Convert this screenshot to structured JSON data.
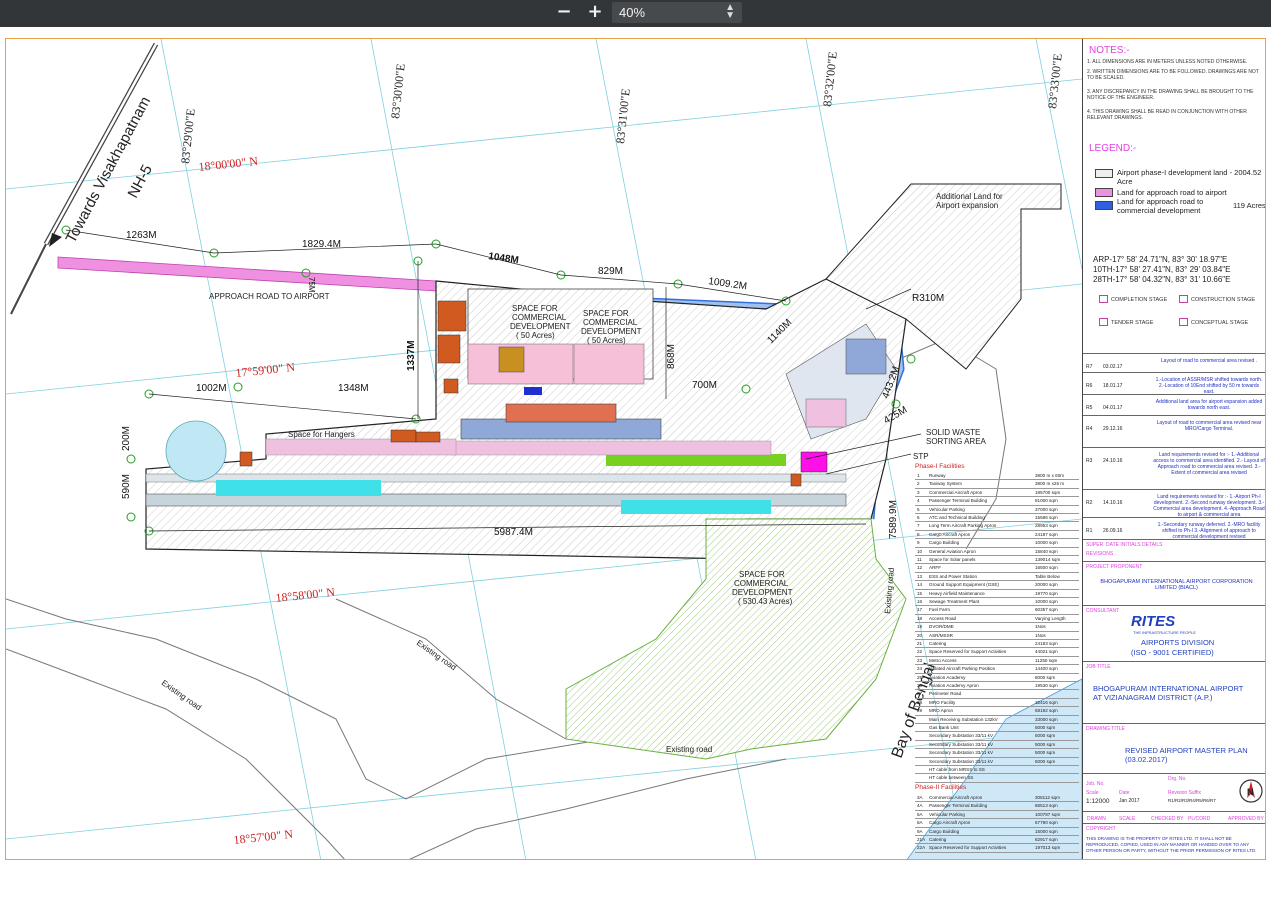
{
  "toolbar": {
    "zoom_out": "−",
    "zoom_in": "+",
    "zoom_value": "40%"
  },
  "map_labels": {
    "towards": "Towards Visakhapatnam",
    "nh5": "NH-5",
    "lon1": "83°29'00\"E",
    "lon2": "83°30'00\"E",
    "lon3": "83°31'00\"E",
    "lon4": "83°32'00\"E",
    "lon5": "83°33'00\"E",
    "lat1": "18°00'00\" N",
    "lat2": "17°59'00\" N",
    "lat3": "18°58'00\" N",
    "lat4": "18°57'00\" N",
    "d1263": "1263M",
    "d1829": "1829.4M",
    "d1048": "1048M",
    "d829": "829M",
    "d1009": "1009.2M",
    "d1140": "1140M",
    "dR310": "R310M",
    "d1337": "1337M",
    "d868": "868M",
    "d700": "700M",
    "d443": "443.2M",
    "d425": "425M",
    "d1002": "1002M",
    "d1348": "1348M",
    "d200": "200M",
    "d590": "590M",
    "d5987": "5987.4M",
    "d7589": "7589.9M",
    "d75": "75M",
    "approach": "APPROACH ROAD TO AIRPORT",
    "space1a": "SPACE FOR",
    "space1b": "COMMERCIAL",
    "space1c": "DEVELOPMENT",
    "space1d": "( 50 Acres)",
    "space3d": "( 530.43 Acres)",
    "hangers": "Space for Hangers",
    "solid1": "SOLID WASTE",
    "solid2": "SORTING AREA",
    "stp": "STP",
    "additional1": "Additional Land for",
    "additional2": "Airport expansion",
    "existing": "Existing road",
    "bay": "Bay of Bengal"
  },
  "notes": {
    "title": "NOTES:-",
    "items": [
      "1. ALL DIMENSIONS ARE IN METERS UNLESS NOTED OTHERWISE.",
      "2. WRITTEN DIMENSIONS ARE TO BE FOLLOWED. DRAWINGS ARE NOT TO BE SCALED.",
      "3. ANY DISCREPANCY IN THE DRAWING SHALL BE BROUGHT TO THE NOTICE OF THE ENGINEER.",
      "4. THIS DRAWING SHALL BE READ IN CONJUNCTION WITH OTHER RELEVANT DRAWINGS."
    ]
  },
  "legend": {
    "title": "LEGEND:-",
    "phase1": "Airport phase-I development land - 2004.52 Acre",
    "approach": "Land for approach road to airport",
    "commercial1": "Land for approach road to",
    "commercial2": "commercial development",
    "acres": "119 Acres",
    "arp": "ARP-17° 58' 24.71\"N, 83° 30' 18.97\"E",
    "th10": "10TH-17° 58' 27.41\"N, 83° 29' 03.84\"E",
    "th28": "28TH-17° 58' 04.32\"N, 83° 31' 10.66\"E",
    "completion": "COMPLETION STAGE",
    "construction": "CONSTRUCTION STAGE",
    "tender": "TENDER STAGE",
    "conceptual": "CONCEPTUAL STAGE"
  },
  "revisions": [
    {
      "no": "R7",
      "date": "03.02.17",
      "text": "Layout of road to commercial area revised ."
    },
    {
      "no": "R6",
      "date": "18.01.17",
      "text": "1.-Location of ASSR/MSR shifted towards north. 2.-Location of 10End shifted by 50 m towards east."
    },
    {
      "no": "R5",
      "date": "04.01.17",
      "text": "Additional land area for airport expansion added towards north east."
    },
    {
      "no": "R4",
      "date": "29.12.16",
      "text": "Layout of road to commercial area revised near MRO/Cargo Terminal."
    },
    {
      "no": "R3",
      "date": "24.10.16",
      "text": "Land requirements revised for :- 1.-Additional access to commercial area identified. 2.- Layout of Approach road to commercial area revised. 3.-Extent of commercial area revised"
    },
    {
      "no": "R2",
      "date": "14.10.16",
      "text": "Land requirements revised for :- 1.-Airport Ph-I development. 2.-Second runway development. 3.-Commercial area development. 4.-Approach Road to airport & commercial area"
    },
    {
      "no": "R1",
      "date": "26.09.16",
      "text": "1.-Secondary runway deferred. 2.-MRO facility shifted to Ph-I 3.-Alignment of approach to commercial development revised"
    }
  ],
  "title_block": {
    "rev_header": "SUPER.   DATE   INITIALS          DETAILS",
    "revisions_lbl": "REVISIONS",
    "proponent_lbl": "PROJECT PROPONENT",
    "proponent": "BHOGAPURAM INTERNATIONAL AIRPORT CORPORATION LIMITED (BIACL)",
    "consultant_lbl": "CONSULTANT",
    "rites": "RITES",
    "rites_tag": "THE INFRASTRUCTURE PEOPLE",
    "division": "AIRPORTS DIVISION",
    "iso": "(ISO - 9001 CERTIFIED)",
    "job_lbl": "JOB TITLE",
    "job1": "BHOGAPURAM INTERNATIONAL AIRPORT",
    "job2": "AT VIZIANAGRAM DISTRICT (A.P.)",
    "drawing_lbl": "DRAWING TITLE",
    "drawing1": "REVISED AIRPORT MASTER PLAN",
    "drawing2": "(03.02.2017)",
    "job_no_lbl": "Job. No.",
    "drg_no_lbl": "Drg. No.",
    "scale_lbl": "Scale",
    "scale": "1:12000",
    "date_lbl": "Date",
    "date": "Jan 2017",
    "revision_lbl": "Revision Suffix",
    "revision": "R1/R2/R3/R4/R5/R6/R7",
    "drawn": "DRAWN",
    "scale2": "SCALE",
    "checked": "CHECKED BY",
    "pl": "PL/CORD",
    "approved": "APPROVED BY",
    "copyright_lbl": "COPYRIGHT",
    "copyright": "THIS DRAWING IS THE PROPERTY OF RITES LTD. IT SHALL NOT BE REPRODUCED, COPIED, USED IN ANY MANNER OR HANDED OVER TO ANY OTHER PERSON OR PARTY, WITHOUT THE PRIOR PERMISSION OF RITES LTD."
  },
  "phase1": {
    "title": "Phase-I Facilities",
    "rows": [
      [
        "1",
        "Runway",
        "3800 m x 60m"
      ],
      [
        "2",
        "Taxiway System",
        "3800 m x25 m"
      ],
      [
        "3",
        "Commercial Aircraft Apron",
        "185700 sqm"
      ],
      [
        "4",
        "Passenger Terminal Building",
        "81000 sqm"
      ],
      [
        "5",
        "Vehicular Parking",
        "37000 sqm"
      ],
      [
        "6",
        "ATC and Technical Building",
        "15586 sqm"
      ],
      [
        "7",
        "Long Term Aircraft Parking Apron",
        "28953 sqm"
      ],
      [
        "8",
        "Cargo Aircraft Apron",
        "24187 sqm"
      ],
      [
        "9",
        "Cargo Building",
        "10000 sqm"
      ],
      [
        "10",
        "General Aviation Apron",
        "15840 sqm"
      ],
      [
        "11",
        "Space for Solar panels",
        "139014 sqm"
      ],
      [
        "12",
        "ARFF",
        "16500 sqm"
      ],
      [
        "13",
        "ESS and Power Station",
        "Table Below"
      ],
      [
        "14",
        "Ground Support Equipment (GSE)",
        "20000 sqm"
      ],
      [
        "15",
        "Heavy Airfield Maintenance",
        "19770 sqm"
      ],
      [
        "16",
        "Sewage Treatment Plant",
        "10000 sqm"
      ],
      [
        "17",
        "Fuel Farm",
        "60357 sqm"
      ],
      [
        "18",
        "Access Road",
        "Varying Length"
      ],
      [
        "19",
        "DVOR/DME",
        "1Nos"
      ],
      [
        "20",
        "ASR/MSSR",
        "1Nos"
      ],
      [
        "21",
        "Catering",
        "24183 sqm"
      ],
      [
        "22",
        "Space Reserved for Support Activities",
        "44021 sqm"
      ],
      [
        "23",
        "Metro Access",
        "11250 sqm"
      ],
      [
        "24",
        "Isolated Aircraft Parking Position",
        "14400 sqm"
      ],
      [
        "25",
        "Aviation Academy",
        "8000 sqm"
      ],
      [
        "26",
        "Aviation Academy Apron",
        "19530 sqm"
      ],
      [
        "27",
        "Perimeter Road",
        ""
      ],
      [
        "28",
        "MRO Facility",
        "32416 sqm"
      ],
      [
        "29",
        "MRO Apron",
        "68192 sqm"
      ],
      [
        "",
        "Main Receiving Substation 132kV",
        "33000 sqm"
      ],
      [
        "",
        "Gas Bank Unit",
        "5000 sqm"
      ],
      [
        "",
        "Secondary Substation 33/11 kV",
        "5000 sqm"
      ],
      [
        "",
        "Secondary Substation 33/11 kV",
        "5000 sqm"
      ],
      [
        "",
        "Secondary Substation 33/11 kV",
        "5000 sqm"
      ],
      [
        "",
        "Secondary Substation 33/11 kV",
        "5000 sqm"
      ],
      [
        "",
        "HT cable from MRSS to SS",
        ""
      ],
      [
        "",
        "HT cable between SS",
        ""
      ]
    ]
  },
  "phase2": {
    "title": "Phase-II Facilities",
    "rows": [
      [
        "3A",
        "Commercial Aircraft Apron",
        "308112 sqm"
      ],
      [
        "4A",
        "Passenger Terminal Building",
        "86513 sqm"
      ],
      [
        "5A",
        "Vehicular Parking",
        "100787 sqm"
      ],
      [
        "8A",
        "Cargo Aircraft Apron",
        "67790 sqm"
      ],
      [
        "9A",
        "Cargo Building",
        "15000 sqm"
      ],
      [
        "21A",
        "Catering",
        "82917 sqm"
      ],
      [
        "22A",
        "Space Reserved for Support Activities",
        "197013 sqm"
      ]
    ]
  }
}
